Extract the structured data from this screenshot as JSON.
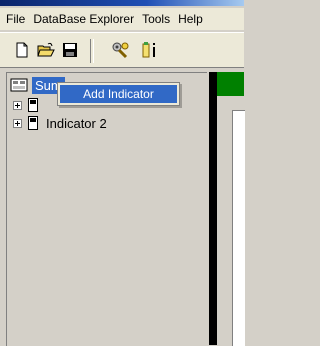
{
  "menu": {
    "items": [
      "File",
      "DataBase Explorer",
      "Tools",
      "Help"
    ]
  },
  "toolbar": {
    "buttons": [
      {
        "icon": "new-document-icon"
      },
      {
        "icon": "open-folder-icon"
      },
      {
        "icon": "save-icon"
      },
      {
        "icon": "tools-icon"
      },
      {
        "icon": "indicator-icon"
      }
    ]
  },
  "tree": {
    "root_label": "Sum",
    "children": [
      {
        "label": ""
      },
      {
        "label": "Indicator 2"
      }
    ]
  },
  "context_menu": {
    "items": [
      "Add Indicator"
    ]
  },
  "colors": {
    "selection": "#3169c6",
    "desktop": "#d4d0c8",
    "menubar": "#ece9d8",
    "green_bar": "#008000"
  }
}
